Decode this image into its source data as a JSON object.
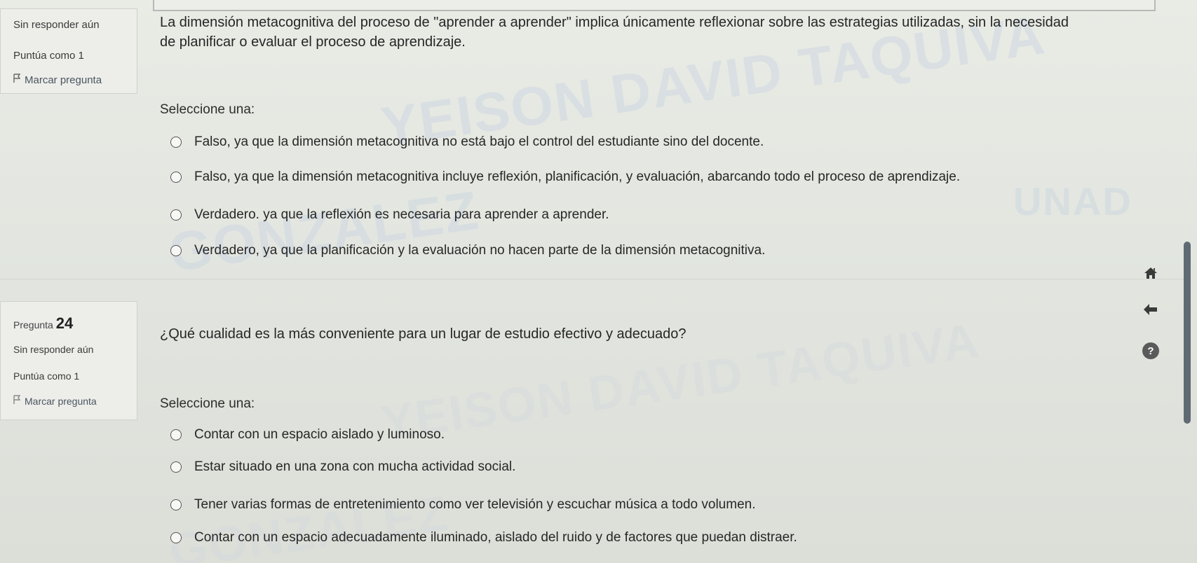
{
  "q23": {
    "status": "Sin responder aún",
    "points": "Puntúa como 1",
    "flag_label": "Marcar pregunta",
    "text_line1": "La dimensión metacognitiva del proceso de \"aprender a aprender\" implica únicamente reflexionar sobre las estrategias utilizadas, sin la necesidad",
    "text_line2": "de planificar o evaluar el proceso de aprendizaje.",
    "select_label": "Seleccione una:",
    "options": [
      "Falso, ya que la dimensión metacognitiva no está bajo el control del estudiante sino del docente.",
      "Falso, ya que la dimensión metacognitiva incluye reflexión, planificación, y evaluación, abarcando todo el proceso de aprendizaje.",
      "Verdadero. ya que la reflexión es necesaria para aprender a aprender.",
      "Verdadero, ya que la planificación y la evaluación no hacen parte de la dimensión metacognitiva."
    ]
  },
  "q24": {
    "label": "Pregunta",
    "number": "24",
    "status": "Sin responder aún",
    "points": "Puntúa como 1",
    "flag_label": "Marcar pregunta",
    "text": "¿Qué cualidad es la más conveniente para un lugar de estudio efectivo y adecuado?",
    "select_label": "Seleccione una:",
    "options": [
      "Contar con un espacio aislado y luminoso.",
      "Estar situado en una zona con mucha actividad social.",
      "Tener varias formas de entretenimiento como ver televisión y escuchar música a todo volumen.",
      "Contar con un espacio adecuadamente iluminado, aislado del ruido y de factores que puedan distraer."
    ]
  },
  "watermark": {
    "line1": "YEISON DAVID TAQUIVA",
    "line2": "GONZALEZ",
    "line3": "UNAD"
  },
  "icons": {
    "home": "home-icon",
    "back": "arrow-left-icon",
    "help": "question-circle-icon",
    "flag": "flag-icon"
  },
  "help_glyph": "?"
}
